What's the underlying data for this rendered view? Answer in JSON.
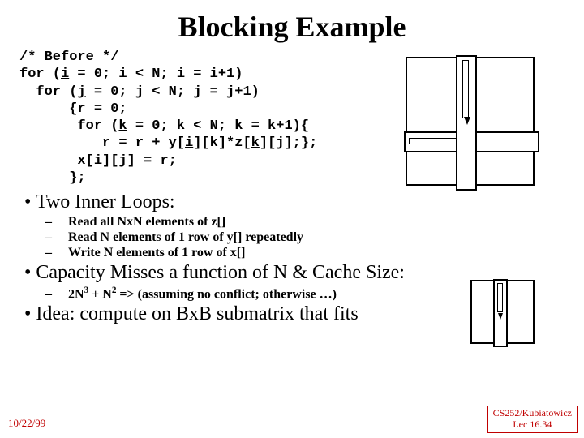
{
  "title": "Blocking Example",
  "code": {
    "l1": "/* Before */",
    "l2a": "for (",
    "l2b": "i",
    "l2c": " = 0; i < N; i = i+1)",
    "l3a": "  for (",
    "l3b": "j",
    "l3c": " = 0; j < N; j = j+1)",
    "l4": "      {r = 0;",
    "l5a": "       for (",
    "l5b": "k",
    "l5c": " = 0; k < N; k = k+1){",
    "l6a": "          r = r + y[",
    "l6b": "i",
    "l6c": "][k]*z[",
    "l6d": "k",
    "l6e": "][j];};",
    "l7a": "       x[",
    "l7b": "i",
    "l7c": "][j] = r;",
    "l8": "      };"
  },
  "bul": {
    "h1": "Two Inner Loops:",
    "h1a": "Read all NxN elements of z[]",
    "h1b": "Read N elements of 1 row of y[] repeatedly",
    "h1c": "Write N elements of 1 row  of x[]",
    "h2": "Capacity Misses a function of N & Cache Size:",
    "h2a_pre": "2N",
    "h2a_sup1": "3",
    "h2a_mid": " + N",
    "h2a_sup2": "2",
    "h2a_post": " => (assuming no conflict; otherwise …)",
    "h3": "Idea: compute on BxB submatrix that fits"
  },
  "footer": {
    "left": "10/22/99",
    "right_top": "CS252/Kubiatowicz",
    "right_bot": "Lec 16.34"
  }
}
